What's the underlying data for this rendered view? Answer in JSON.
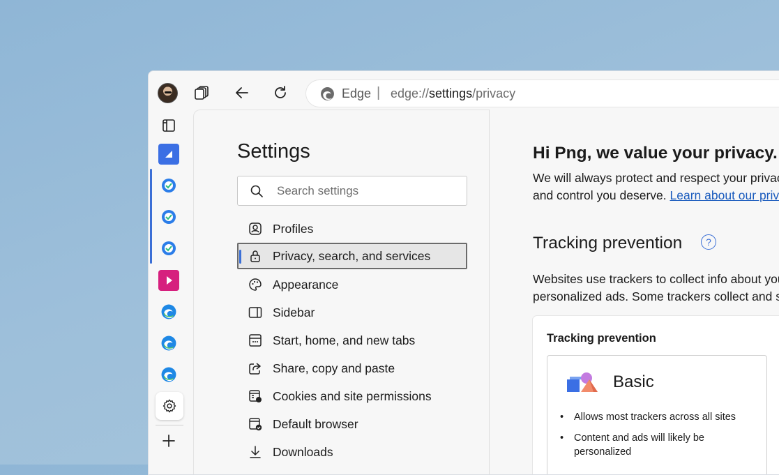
{
  "toolbar": {
    "brand": "Edge",
    "separator": "|",
    "url_prefix": "edge://",
    "url_path": "settings",
    "url_suffix": "/privacy"
  },
  "sidebar": {
    "items": [
      {
        "name": "vertical-tabs-icon"
      },
      {
        "name": "app-blue-icon"
      },
      {
        "name": "copilot-icon"
      },
      {
        "name": "copilot-icon"
      },
      {
        "name": "copilot-icon"
      },
      {
        "name": "app-pink-icon"
      },
      {
        "name": "edge-icon"
      },
      {
        "name": "edge-icon"
      },
      {
        "name": "edge-icon"
      },
      {
        "name": "gear-icon"
      },
      {
        "name": "add-icon"
      }
    ]
  },
  "settings": {
    "title": "Settings",
    "search_placeholder": "Search settings",
    "nav": [
      {
        "label": "Profiles",
        "icon": "profiles-icon"
      },
      {
        "label": "Privacy, search, and services",
        "icon": "lock-icon",
        "active": true
      },
      {
        "label": "Appearance",
        "icon": "palette-icon"
      },
      {
        "label": "Sidebar",
        "icon": "sidebar-icon"
      },
      {
        "label": "Start, home, and new tabs",
        "icon": "home-tabs-icon"
      },
      {
        "label": "Share, copy and paste",
        "icon": "share-icon"
      },
      {
        "label": "Cookies and site permissions",
        "icon": "cookies-icon"
      },
      {
        "label": "Default browser",
        "icon": "default-browser-icon"
      },
      {
        "label": "Downloads",
        "icon": "download-icon"
      }
    ]
  },
  "main": {
    "greeting": "Hi Png, we value your privacy.",
    "intro_line1": "We will always protect and respect your privac",
    "intro_line2": "and control you deserve. ",
    "intro_link": "Learn about our priv",
    "tracking_title": "Tracking prevention",
    "help_label": "?",
    "tracking_desc1": "Websites use trackers to collect info about you",
    "tracking_desc2": "personalized ads. Some trackers collect and se",
    "card_title": "Tracking prevention",
    "option_title": "Basic",
    "option_bullets": [
      "Allows most trackers across all sites",
      "Content and ads will likely be personalized"
    ]
  },
  "colors": {
    "accent": "#3b6fd6",
    "link": "#1a5bbd",
    "pink_app": "#d6207e"
  }
}
